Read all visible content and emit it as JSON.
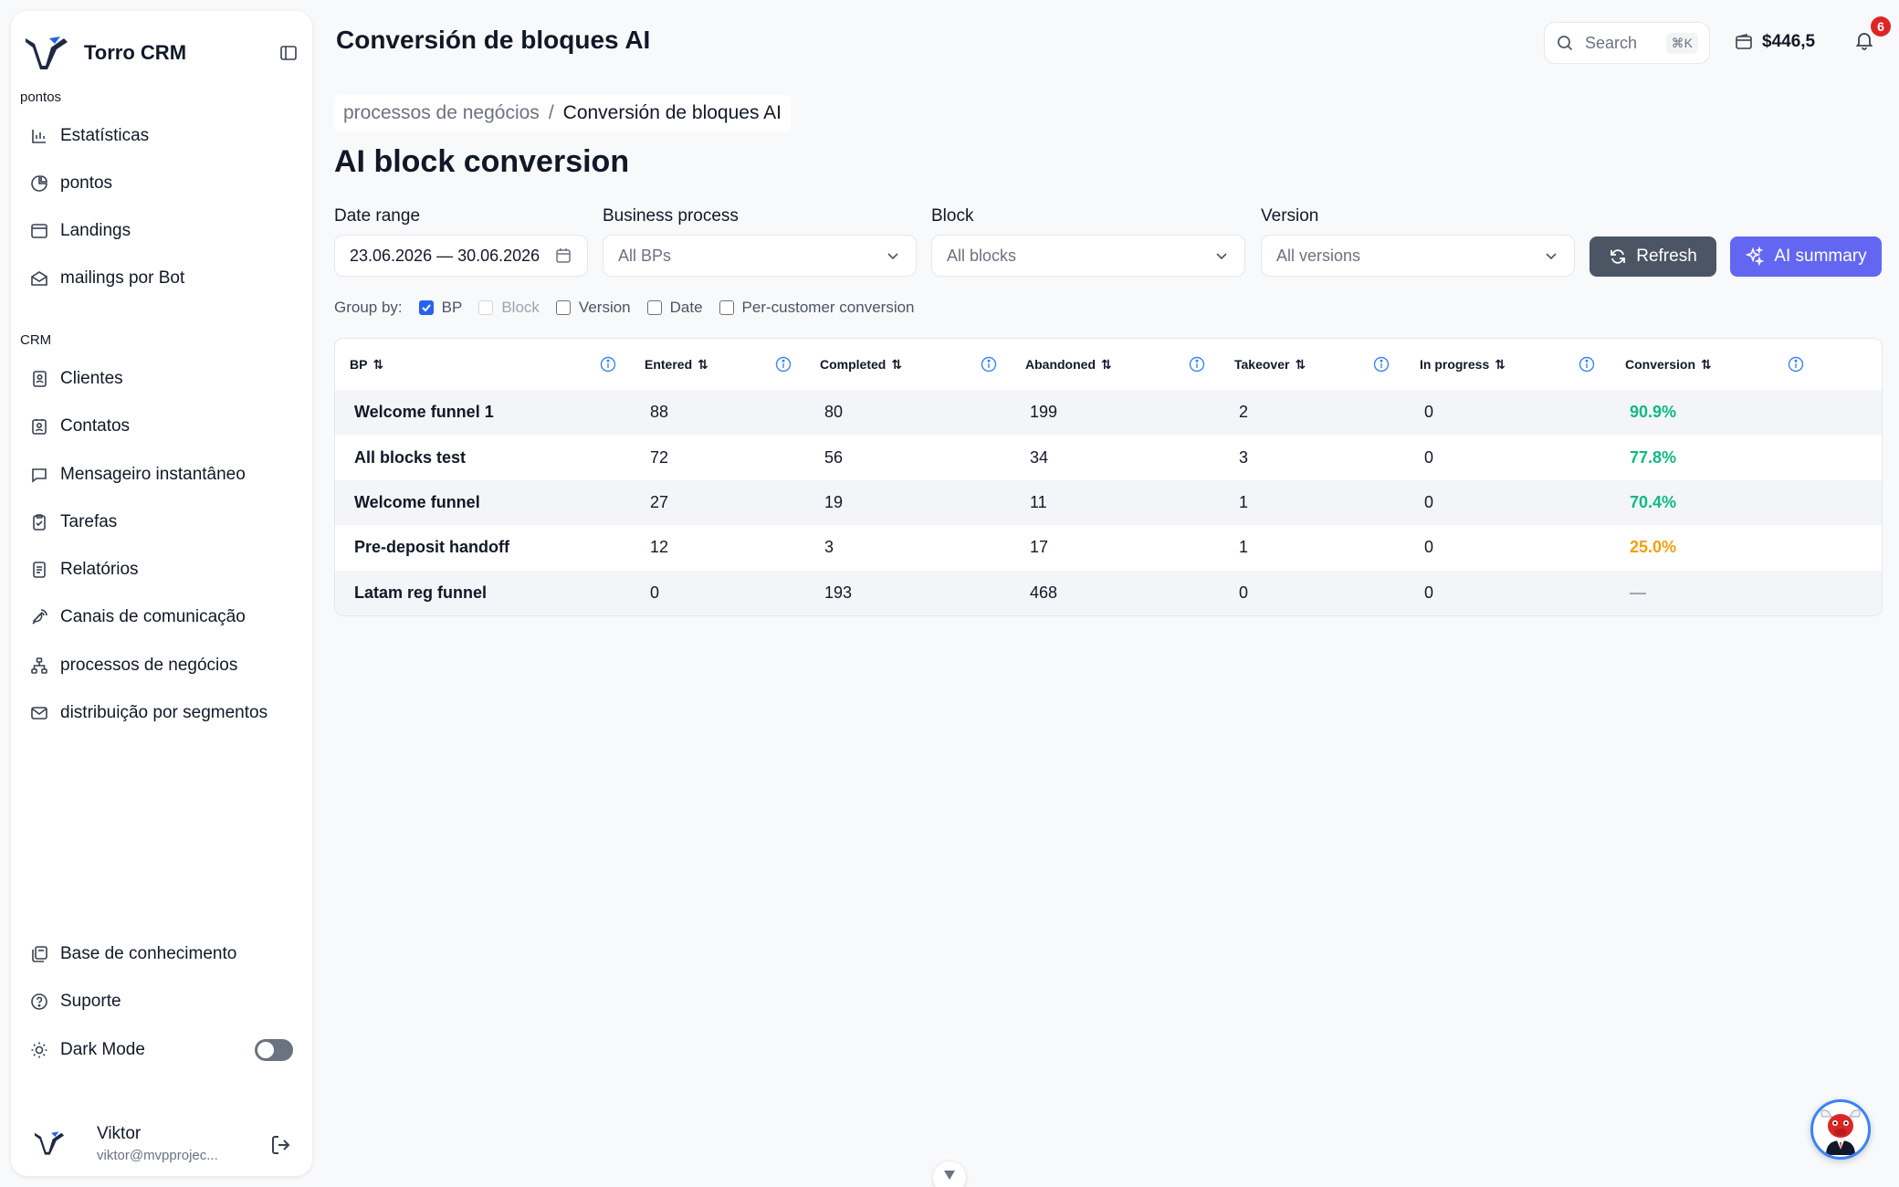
{
  "app": {
    "name": "Torro CRM"
  },
  "sidebar": {
    "section_points": "pontos",
    "points_items": [
      {
        "label": "Estatísticas",
        "icon": "bar-chart-icon"
      },
      {
        "label": "pontos",
        "icon": "pie-chart-icon"
      },
      {
        "label": "Landings",
        "icon": "browser-window-icon"
      },
      {
        "label": "mailings por Bot",
        "icon": "mail-open-icon"
      }
    ],
    "section_crm": "CRM",
    "crm_items": [
      {
        "label": "Clientes",
        "icon": "contact-book-icon"
      },
      {
        "label": "Contatos",
        "icon": "contact-card-icon"
      },
      {
        "label": "Mensageiro instantâneo",
        "icon": "chat-bubble-icon"
      },
      {
        "label": "Tarefas",
        "icon": "clipboard-icon"
      },
      {
        "label": "Relatórios",
        "icon": "document-icon"
      },
      {
        "label": "Canais de comunicação",
        "icon": "satellite-icon"
      },
      {
        "label": "processos de negócios",
        "icon": "flow-tree-icon"
      },
      {
        "label": "distribuição por segmentos",
        "icon": "envelope-icon"
      }
    ],
    "bottom_items": [
      {
        "label": "Base de conhecimento",
        "icon": "knowledge-base-icon"
      },
      {
        "label": "Suporte",
        "icon": "help-circle-icon"
      }
    ],
    "dark_mode_label": "Dark Mode",
    "dark_mode_on": false,
    "user": {
      "name": "Viktor",
      "email": "viktor@mvpprojec..."
    }
  },
  "header": {
    "title": "Conversión de bloques AI",
    "search_placeholder": "Search",
    "search_shortcut": "⌘K",
    "balance": "$446,5",
    "notifications_count": "6"
  },
  "breadcrumb": {
    "parent": "processos de negócios",
    "separator": "/",
    "current": "Conversión de bloques AI"
  },
  "page": {
    "title": "AI block conversion"
  },
  "filters": {
    "date_range_label": "Date range",
    "date_range_value": "23.06.2026 — 30.06.2026",
    "bp_label": "Business process",
    "bp_value": "All BPs",
    "block_label": "Block",
    "block_value": "All blocks",
    "version_label": "Version",
    "version_value": "All versions",
    "refresh_label": "Refresh",
    "ai_summary_label": "AI summary"
  },
  "group_by": {
    "label": "Group by:",
    "options": [
      {
        "label": "BP",
        "checked": true,
        "disabled": false
      },
      {
        "label": "Block",
        "checked": false,
        "disabled": true
      },
      {
        "label": "Version",
        "checked": false,
        "disabled": false
      },
      {
        "label": "Date",
        "checked": false,
        "disabled": false
      },
      {
        "label": "Per-customer conversion",
        "checked": false,
        "disabled": false
      }
    ]
  },
  "table": {
    "columns": [
      "BP",
      "Entered",
      "Completed",
      "Abandoned",
      "Takeover",
      "In progress",
      "Conversion"
    ],
    "rows": [
      {
        "bp": "Welcome funnel 1",
        "entered": "88",
        "completed": "80",
        "abandoned": "199",
        "takeover": "2",
        "in_progress": "0",
        "conversion": "90.9%",
        "conversion_color": "#10b981"
      },
      {
        "bp": "All blocks test",
        "entered": "72",
        "completed": "56",
        "abandoned": "34",
        "takeover": "3",
        "in_progress": "0",
        "conversion": "77.8%",
        "conversion_color": "#10b981"
      },
      {
        "bp": "Welcome funnel",
        "entered": "27",
        "completed": "19",
        "abandoned": "11",
        "takeover": "1",
        "in_progress": "0",
        "conversion": "70.4%",
        "conversion_color": "#10b981"
      },
      {
        "bp": "Pre-deposit handoff",
        "entered": "12",
        "completed": "3",
        "abandoned": "17",
        "takeover": "1",
        "in_progress": "0",
        "conversion": "25.0%",
        "conversion_color": "#f59e0b"
      },
      {
        "bp": "Latam reg funnel",
        "entered": "0",
        "completed": "193",
        "abandoned": "468",
        "takeover": "0",
        "in_progress": "0",
        "conversion": "—",
        "conversion_color": "#9ca3af"
      }
    ]
  },
  "colors": {
    "accent": "#6366f1",
    "checkbox": "#2563eb",
    "success": "#10b981",
    "warning": "#f59e0b",
    "danger": "#dc2626",
    "info_icon": "#3b82f6"
  }
}
